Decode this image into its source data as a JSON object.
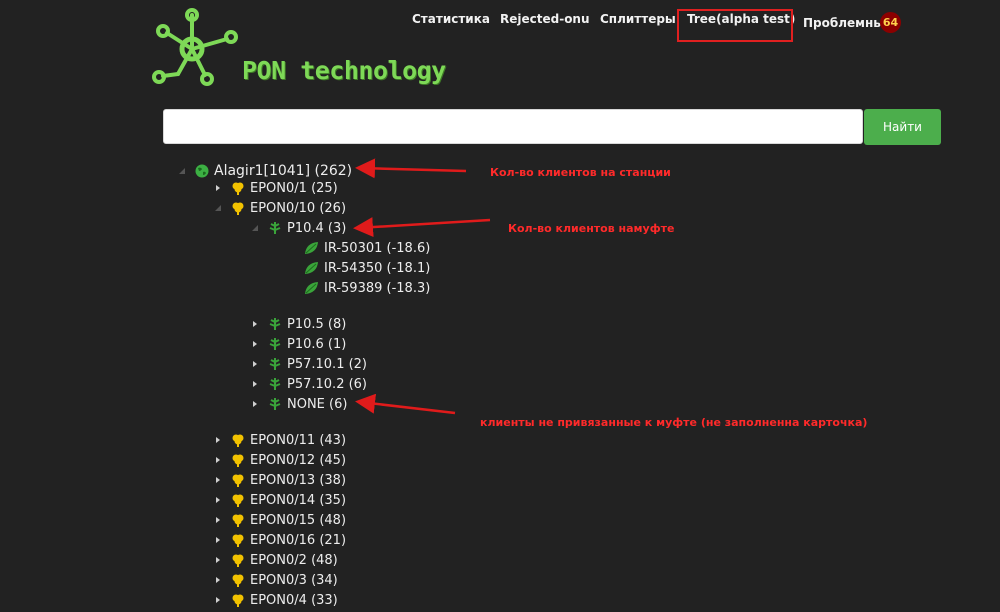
{
  "header": {
    "logo_text": "PON technology",
    "nav": [
      {
        "label": "Статистика",
        "icon": "none"
      },
      {
        "label": "Rejected-onu",
        "icon": "none"
      },
      {
        "label": "Сплиттеры",
        "icon": "none"
      },
      {
        "label": "Tree(alpha test)",
        "icon": "none"
      },
      {
        "label": "Проблемные",
        "icon": "none"
      }
    ],
    "problem_count": "64"
  },
  "search": {
    "value": "",
    "placeholder": "",
    "button_label": "Найти"
  },
  "tree": {
    "station": {
      "label": "Alagir1[1041] (262)",
      "icon": "globe-icon"
    },
    "ports_top": [
      {
        "label": "EPON0/1 (25)",
        "expanded": false
      },
      {
        "label": "EPON0/10 (26)",
        "expanded": true
      }
    ],
    "open_splitter": {
      "label": "P10.4 (3)",
      "expanded": true
    },
    "clients": [
      {
        "label": "IR-50301 (-18.6)"
      },
      {
        "label": "IR-54350 (-18.1)"
      },
      {
        "label": "IR-59389 (-18.3)"
      }
    ],
    "splitters": [
      {
        "label": "P10.5 (8)"
      },
      {
        "label": "P10.6 (1)"
      },
      {
        "label": "P57.10.1 (2)"
      },
      {
        "label": "P57.10.2 (6)"
      },
      {
        "label": "NONE (6)"
      }
    ],
    "ports_bottom": [
      {
        "label": "EPON0/11 (43)"
      },
      {
        "label": "EPON0/12 (45)"
      },
      {
        "label": "EPON0/13 (38)"
      },
      {
        "label": "EPON0/14 (35)"
      },
      {
        "label": "EPON0/15 (48)"
      },
      {
        "label": "EPON0/16 (21)"
      },
      {
        "label": "EPON0/2 (48)"
      },
      {
        "label": "EPON0/3 (34)"
      },
      {
        "label": "EPON0/4 (33)"
      }
    ]
  },
  "annotations": [
    {
      "text": "Кол-во клиентов на станции"
    },
    {
      "text": "Кол-во клиентов намуфте"
    },
    {
      "text": "клиенты не привязанные к муфте (не заполненна карточка)"
    }
  ],
  "colors": {
    "background": "#222222",
    "logo_green": "#7ed957",
    "button_green": "#4cae4c",
    "annotation_red": "#ff2a2a",
    "port_icon": "#f2c200",
    "leaf_icon": "#3aa43a",
    "globe_icon": "#3cb043"
  }
}
